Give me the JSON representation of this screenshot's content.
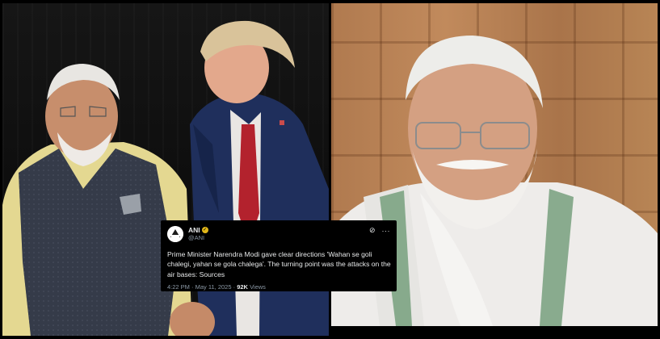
{
  "tweet": {
    "name": "ANI",
    "handle": "@ANI",
    "avatar_text": "ANI",
    "text": "Prime Minister Narendra Modi gave clear directions 'Wahan se goli chalegi, yahan se gola chalega'. The turning point was the attacks on the air bases: Sources",
    "time": "4:22 PM",
    "separator": "·",
    "date": "May 11, 2025",
    "views_count": "92K",
    "views_label": "Views"
  },
  "colors": {
    "left_background": "#111111",
    "right_background": "#b98555",
    "tweet_background": "#000000",
    "verified_badge": "#e2b719"
  },
  "icons": {
    "verified": "verified-badge-icon",
    "grok": "grok-icon",
    "more": "more-options-icon"
  }
}
